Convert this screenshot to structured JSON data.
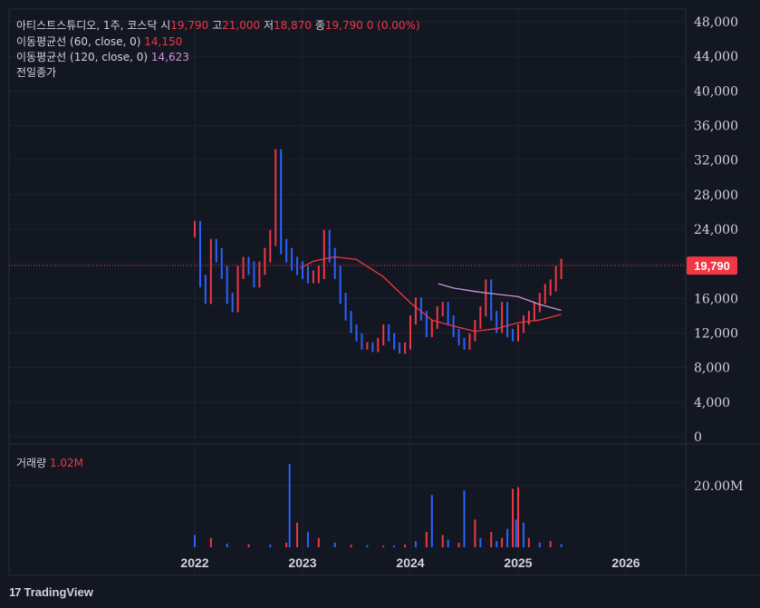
{
  "legend": {
    "symbol": "아티스트스튜디오, 1주, 코스닥",
    "open_label": "시",
    "open": "19,790",
    "high_label": "고",
    "high": "21,000",
    "low_label": "저",
    "low": "18,870",
    "close_label": "종",
    "close": "19,790",
    "change": "0 (0.00%)",
    "ma60_label": "이동평균선 (60, close, 0)",
    "ma60_value": "14,150",
    "ma120_label": "이동평균선 (120, close, 0)",
    "ma120_value": "14,623",
    "prev_close_label": "전일종가",
    "volume_label": "거래량",
    "volume_value": "1.02M"
  },
  "brand": {
    "name": "TradingView"
  },
  "colors": {
    "up": "#f23645",
    "down": "#2962ff",
    "ma60": "#f23645",
    "ma120": "#ce93d8",
    "bg": "#131722"
  },
  "chart_data": {
    "type": "line",
    "title": "아티스트스튜디오, 1주, 코스닥",
    "xlabel": "",
    "ylabel": "",
    "current_price_label": "19,790",
    "current_price": 19790,
    "ylim": [
      0,
      49000
    ],
    "yticks": [
      0,
      4000,
      8000,
      12000,
      16000,
      20000,
      24000,
      28000,
      32000,
      36000,
      40000,
      44000,
      48000
    ],
    "ytick_labels": [
      "0",
      "4,000",
      "8,000",
      "12,000",
      "16,000",
      "20,000",
      "24,000",
      "28,000",
      "32,000",
      "36,000",
      "40,000",
      "44,000",
      "48,000"
    ],
    "xticks": [
      2022,
      2023,
      2024,
      2025,
      2026
    ],
    "xtick_labels": [
      "2022",
      "2023",
      "2024",
      "2025",
      "2026"
    ],
    "series": [
      {
        "name": "이동평균선 (60, close, 0)",
        "x": [
          2022.98,
          2023.1,
          2023.3,
          2023.5,
          2023.75,
          2024.0,
          2024.2,
          2024.4,
          2024.6,
          2024.8,
          2025.0,
          2025.2,
          2025.4
        ],
        "y": [
          19500,
          20300,
          20800,
          20500,
          18500,
          15500,
          13500,
          12800,
          12200,
          12500,
          13200,
          13500,
          14150
        ]
      },
      {
        "name": "이동평균선 (120, close, 0)",
        "x": [
          2024.26,
          2024.4,
          2024.6,
          2024.8,
          2025.0,
          2025.2,
          2025.4
        ],
        "y": [
          17700,
          17200,
          16800,
          16500,
          16200,
          15300,
          14623
        ]
      }
    ],
    "price": {
      "x": [
        2022.0,
        2022.05,
        2022.1,
        2022.15,
        2022.2,
        2022.25,
        2022.3,
        2022.35,
        2022.4,
        2022.45,
        2022.5,
        2022.55,
        2022.6,
        2022.65,
        2022.7,
        2022.75,
        2022.8,
        2022.85,
        2022.9,
        2022.95,
        2023.0,
        2023.05,
        2023.1,
        2023.15,
        2023.2,
        2023.25,
        2023.3,
        2023.35,
        2023.4,
        2023.45,
        2023.5,
        2023.55,
        2023.6,
        2023.65,
        2023.7,
        2023.75,
        2023.8,
        2023.85,
        2023.9,
        2023.95,
        2024.0,
        2024.05,
        2024.1,
        2024.15,
        2024.2,
        2024.25,
        2024.3,
        2024.35,
        2024.4,
        2024.45,
        2024.5,
        2024.55,
        2024.6,
        2024.65,
        2024.7,
        2024.75,
        2024.8,
        2024.85,
        2024.9,
        2024.95,
        2025.0,
        2025.05,
        2025.1,
        2025.15,
        2025.2,
        2025.25,
        2025.3,
        2025.35,
        2025.4
      ],
      "y": [
        24000,
        18000,
        16000,
        22000,
        21000,
        19000,
        16000,
        15000,
        19000,
        20000,
        19500,
        18000,
        19500,
        21000,
        23000,
        32000,
        22000,
        21000,
        20000,
        19500,
        19000,
        18500,
        18500,
        19000,
        23000,
        21000,
        19000,
        16000,
        14000,
        12500,
        11500,
        10500,
        10500,
        10200,
        11000,
        12500,
        11500,
        10500,
        10000,
        10500,
        13500,
        15500,
        14000,
        12000,
        13000,
        14500,
        15000,
        13500,
        12000,
        11000,
        10500,
        11500,
        13000,
        14500,
        17500,
        14000,
        12500,
        15000,
        12000,
        11500,
        12500,
        13500,
        14000,
        15000,
        16000,
        17000,
        17500,
        19000,
        19790
      ]
    },
    "volume": {
      "label": "거래량",
      "ytick_labels": [
        "20.00M"
      ],
      "yticks": [
        20000000
      ],
      "ylim": [
        0,
        28000000
      ],
      "x": [
        2022.0,
        2022.15,
        2022.3,
        2022.5,
        2022.7,
        2022.85,
        2022.88,
        2022.95,
        2023.05,
        2023.15,
        2023.3,
        2023.45,
        2023.6,
        2023.75,
        2023.85,
        2023.95,
        2024.05,
        2024.15,
        2024.2,
        2024.3,
        2024.35,
        2024.45,
        2024.5,
        2024.6,
        2024.65,
        2024.75,
        2024.8,
        2024.85,
        2024.9,
        2024.95,
        2024.98,
        2025.0,
        2025.05,
        2025.1,
        2025.2,
        2025.3,
        2025.4
      ],
      "y": [
        4000000,
        3000000,
        1200000,
        1000000,
        900000,
        1500000,
        27000000,
        8000000,
        5000000,
        3000000,
        1500000,
        800000,
        700000,
        500000,
        600000,
        900000,
        2000000,
        5000000,
        17000000,
        4000000,
        2500000,
        1500000,
        18500000,
        9000000,
        3000000,
        5000000,
        2000000,
        3000000,
        6000000,
        19000000,
        9000000,
        19500000,
        8000000,
        3000000,
        1500000,
        2000000,
        1020000
      ]
    }
  }
}
